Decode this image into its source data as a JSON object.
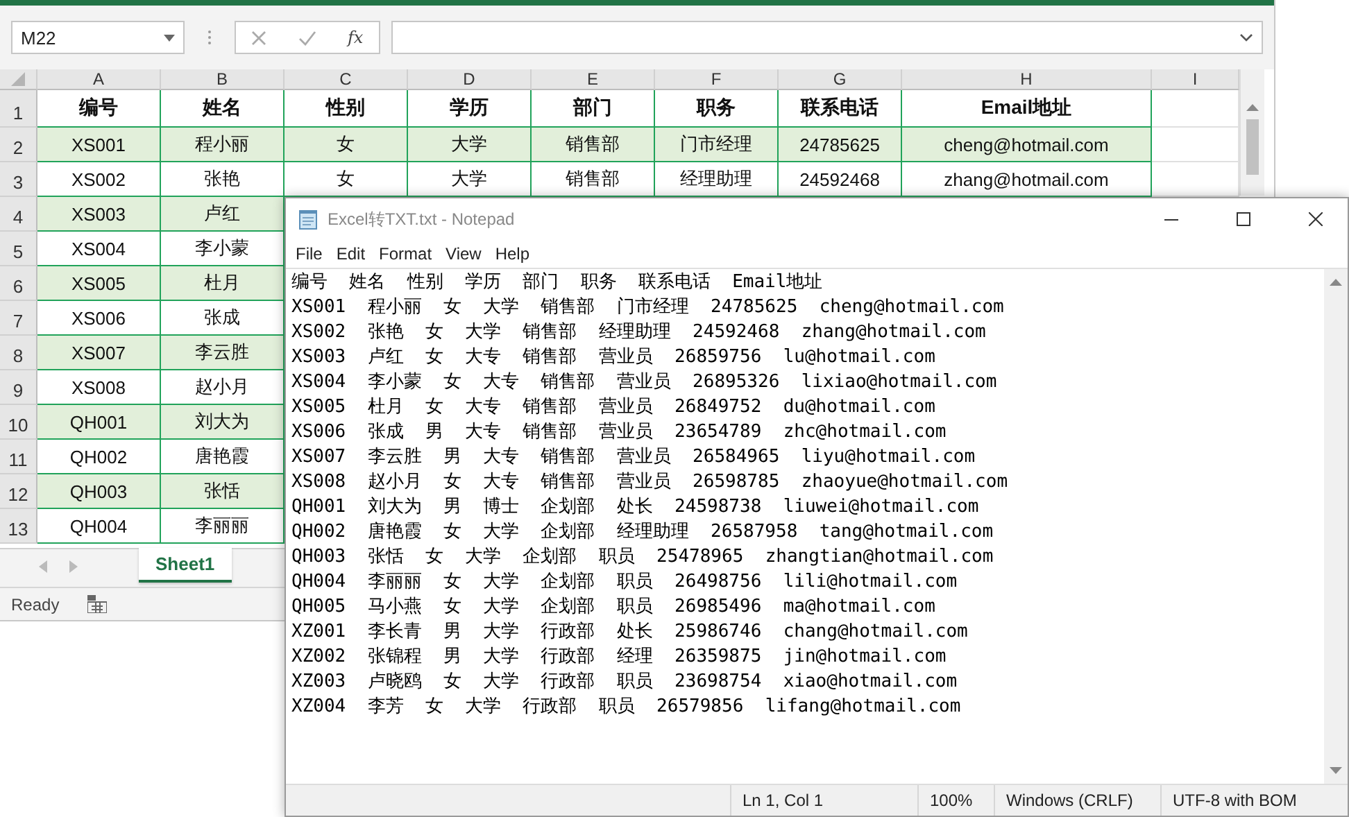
{
  "excel": {
    "name_box": "M22",
    "formula_icon_text": "fx",
    "columns": [
      "A",
      "B",
      "C",
      "D",
      "E",
      "F",
      "G",
      "H",
      "I"
    ],
    "rows": [
      {
        "number": "1",
        "kind": "header",
        "shaded": false,
        "cells": [
          "编号",
          "姓名",
          "性别",
          "学历",
          "部门",
          "职务",
          "联系电话",
          "Email地址"
        ]
      },
      {
        "number": "2",
        "kind": "data",
        "shaded": true,
        "cells": [
          "XS001",
          "程小丽",
          "女",
          "大学",
          "销售部",
          "门市经理",
          "24785625",
          "cheng@hotmail.com"
        ]
      },
      {
        "number": "3",
        "kind": "data",
        "shaded": false,
        "cells": [
          "XS002",
          "张艳",
          "女",
          "大学",
          "销售部",
          "经理助理",
          "24592468",
          "zhang@hotmail.com"
        ]
      },
      {
        "number": "4",
        "kind": "data",
        "shaded": true,
        "cells": [
          "XS003",
          "卢红"
        ]
      },
      {
        "number": "5",
        "kind": "data",
        "shaded": false,
        "cells": [
          "XS004",
          "李小蒙"
        ]
      },
      {
        "number": "6",
        "kind": "data",
        "shaded": true,
        "cells": [
          "XS005",
          "杜月"
        ]
      },
      {
        "number": "7",
        "kind": "data",
        "shaded": false,
        "cells": [
          "XS006",
          "张成"
        ]
      },
      {
        "number": "8",
        "kind": "data",
        "shaded": true,
        "cells": [
          "XS007",
          "李云胜"
        ]
      },
      {
        "number": "9",
        "kind": "data",
        "shaded": false,
        "cells": [
          "XS008",
          "赵小月"
        ]
      },
      {
        "number": "10",
        "kind": "data",
        "shaded": true,
        "cells": [
          "QH001",
          "刘大为"
        ]
      },
      {
        "number": "11",
        "kind": "data",
        "shaded": false,
        "cells": [
          "QH002",
          "唐艳霞"
        ]
      },
      {
        "number": "12",
        "kind": "data",
        "shaded": true,
        "cells": [
          "QH003",
          "张恬"
        ]
      },
      {
        "number": "13",
        "kind": "data",
        "shaded": false,
        "cells": [
          "QH004",
          "李丽丽"
        ]
      }
    ],
    "sheet_tabs": [
      {
        "label": "Sheet1",
        "selected": true
      }
    ],
    "status": "Ready"
  },
  "notepad": {
    "title": "Excel转TXT.txt - Notepad",
    "menu": [
      "File",
      "Edit",
      "Format",
      "View",
      "Help"
    ],
    "lines": [
      "编号  姓名  性别  学历  部门  职务  联系电话  Email地址",
      "XS001  程小丽  女  大学  销售部  门市经理  24785625  cheng@hotmail.com",
      "XS002  张艳  女  大学  销售部  经理助理  24592468  zhang@hotmail.com",
      "XS003  卢红  女  大专  销售部  营业员  26859756  lu@hotmail.com",
      "XS004  李小蒙  女  大专  销售部  营业员  26895326  lixiao@hotmail.com",
      "XS005  杜月  女  大专  销售部  营业员  26849752  du@hotmail.com",
      "XS006  张成  男  大专  销售部  营业员  23654789  zhc@hotmail.com",
      "XS007  李云胜  男  大专  销售部  营业员  26584965  liyu@hotmail.com",
      "XS008  赵小月  女  大专  销售部  营业员  26598785  zhaoyue@hotmail.com",
      "QH001  刘大为  男  博士  企划部  处长  24598738  liuwei@hotmail.com",
      "QH002  唐艳霞  女  大学  企划部  经理助理  26587958  tang@hotmail.com",
      "QH003  张恬  女  大学  企划部  职员  25478965  zhangtian@hotmail.com",
      "QH004  李丽丽  女  大学  企划部  职员  26498756  lili@hotmail.com",
      "QH005  马小燕  女  大学  企划部  职员  26985496  ma@hotmail.com",
      "XZ001  李长青  男  大学  行政部  处长  25986746  chang@hotmail.com",
      "XZ002  张锦程  男  大学  行政部  经理  26359875  jin@hotmail.com",
      "XZ003  卢晓鸥  女  大学  行政部  职员  23698754  xiao@hotmail.com",
      "XZ004  李芳  女  大学  行政部  职员  26579856  lifang@hotmail.com"
    ],
    "status": [
      "Ln 1, Col 1",
      "100%",
      "Windows (CRLF)",
      "UTF-8 with BOM"
    ]
  }
}
